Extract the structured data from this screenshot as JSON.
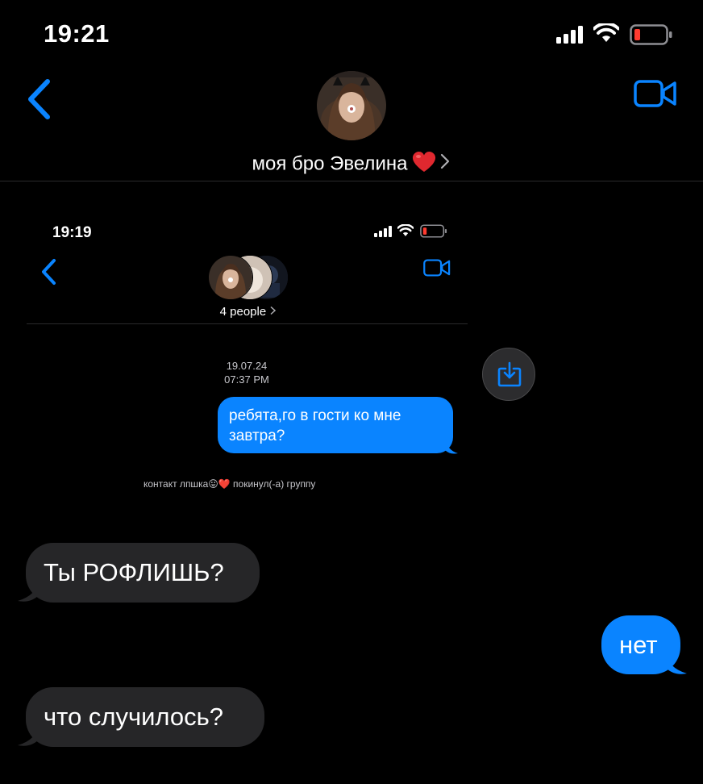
{
  "status_bar": {
    "time": "19:21"
  },
  "header": {
    "contact_name": "моя бро Эвелина"
  },
  "embedded_screenshot": {
    "time": "19:19",
    "group_label": "4 people",
    "date": "19.07.24",
    "timestamp": "07:37 PM",
    "message": "ребята,го в гости ко мне завтра?",
    "notice": "контакт лпшка😛❤️ покинул(-а) группу"
  },
  "messages": [
    {
      "direction": "incoming",
      "text": "Ты РОФЛИШЬ?"
    },
    {
      "direction": "outgoing",
      "text": "нет"
    },
    {
      "direction": "incoming",
      "text": "что случилось?"
    }
  ],
  "colors": {
    "accent": "#0a84ff",
    "incoming_bubble": "#262628",
    "battery_low": "#ff3b30",
    "background": "#000000"
  },
  "icons": [
    "back-chevron-icon",
    "video-call-icon",
    "heart-icon",
    "chevron-right-icon",
    "signal-icon",
    "wifi-icon",
    "battery-icon",
    "save-download-icon"
  ]
}
